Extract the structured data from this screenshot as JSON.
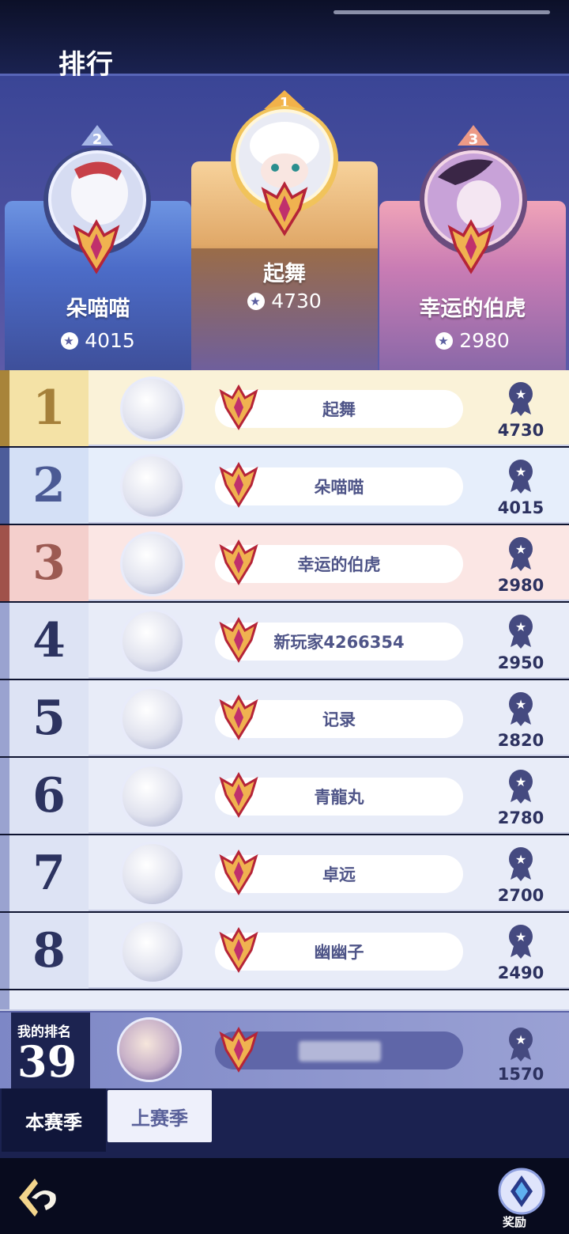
{
  "header": {
    "title": "排行"
  },
  "podium": [
    {
      "rank": "2",
      "name": "朵喵喵",
      "score": "4015"
    },
    {
      "rank": "1",
      "name": "起舞",
      "score": "4730"
    },
    {
      "rank": "3",
      "name": "幸运的伯虎",
      "score": "2980"
    }
  ],
  "rows": [
    {
      "rank": "1",
      "name": "起舞",
      "score": "4730"
    },
    {
      "rank": "2",
      "name": "朵喵喵",
      "score": "4015"
    },
    {
      "rank": "3",
      "name": "幸运的伯虎",
      "score": "2980"
    },
    {
      "rank": "4",
      "name": "新玩家4266354",
      "score": "2950"
    },
    {
      "rank": "5",
      "name": "记录",
      "score": "2820"
    },
    {
      "rank": "6",
      "name": "青龍丸",
      "score": "2780"
    },
    {
      "rank": "7",
      "name": "卓远",
      "score": "2700"
    },
    {
      "rank": "8",
      "name": "幽幽子",
      "score": "2490"
    }
  ],
  "my_rank": {
    "label": "我的排名",
    "rank": "39",
    "score": "1570"
  },
  "tabs": {
    "current": "本赛季",
    "last": "上赛季"
  },
  "bottom": {
    "reward_label": "奖励"
  },
  "colors": {
    "gold": "#f4e0a0",
    "silver": "#dde7f8",
    "bronze": "#f6dfe2",
    "row": "#e8ecf8",
    "accent": "#4e5598"
  },
  "icons": [
    "medal-icon",
    "crest-icon",
    "back-icon",
    "reward-icon"
  ]
}
